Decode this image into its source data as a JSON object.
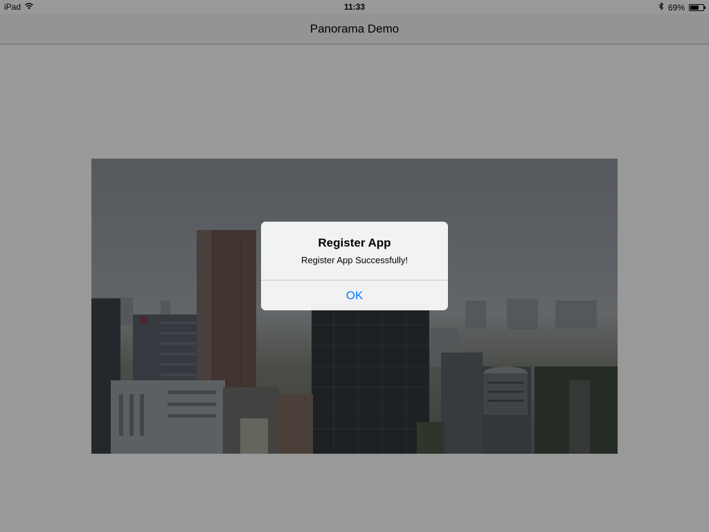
{
  "status_bar": {
    "device": "iPad",
    "time": "11:33",
    "battery_percent": "69%",
    "battery_level": 0.69,
    "icons": [
      "wifi-icon",
      "bluetooth-icon",
      "battery-icon"
    ]
  },
  "nav_bar": {
    "title": "Panorama Demo"
  },
  "alert": {
    "title": "Register App",
    "message": "Register App Successfully!",
    "button_label": "OK"
  },
  "colors": {
    "accent": "#007aff",
    "overlay": "rgba(0,0,0,0.4)",
    "nav_background": "#f7f7f7"
  }
}
